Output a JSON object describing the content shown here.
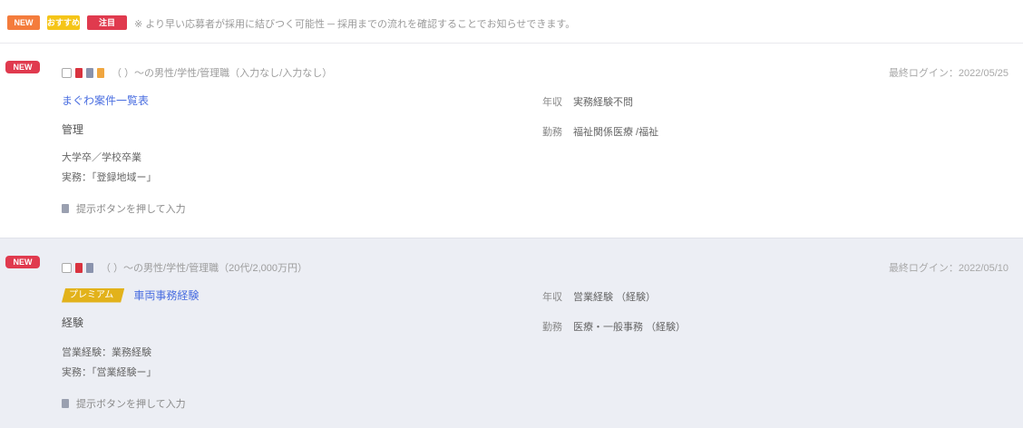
{
  "notice": {
    "badges": [
      {
        "label": "NEW",
        "color": "#f47c3c"
      },
      {
        "label": "おすすめ",
        "color": "#f5c518"
      },
      {
        "label": "注目",
        "color": "#e03a4e"
      }
    ],
    "text": "※ より早い応募者が採用に結びつく可能性 ─ 採用までの流れを確認することでお知らせできます。"
  },
  "listings": [
    {
      "badge": "NEW",
      "meta": "（ ）～の男性/学性/管理職（入力なし/入力なし）",
      "last_login": "最終ログイン：2022/05/25",
      "title": "まぐわ案件一覧表",
      "category": "管理",
      "education": "大学卒／学校卒業",
      "experience": "実務：「登録地域ー」",
      "contact": "提示ボタンを押して入力",
      "details": [
        {
          "label": "年収",
          "value": "実務経験不問"
        },
        {
          "label": "勤務",
          "value": "福祉関係医療 /福祉"
        }
      ]
    },
    {
      "badge": "NEW",
      "meta": "（ ）～の男性/学性/管理職（20代/2,000万円）",
      "last_login": "最終ログイン：2022/05/10",
      "premium": "プレミアム",
      "title": "車両事務経験",
      "category": "経験",
      "education": "営業経験：業務経験",
      "experience": "実務：「営業経験ー」",
      "contact": "提示ボタンを押して入力",
      "details": [
        {
          "label": "年収",
          "value": "営業経験 （経験）"
        },
        {
          "label": "勤務",
          "value": "医療・一般事務 （経験）"
        }
      ]
    }
  ],
  "colors": {
    "accent_red": "#e03a4e",
    "link_blue": "#4a6ee0",
    "premium_yellow": "#e2b21b",
    "alt_row_bg": "#eceef4"
  }
}
